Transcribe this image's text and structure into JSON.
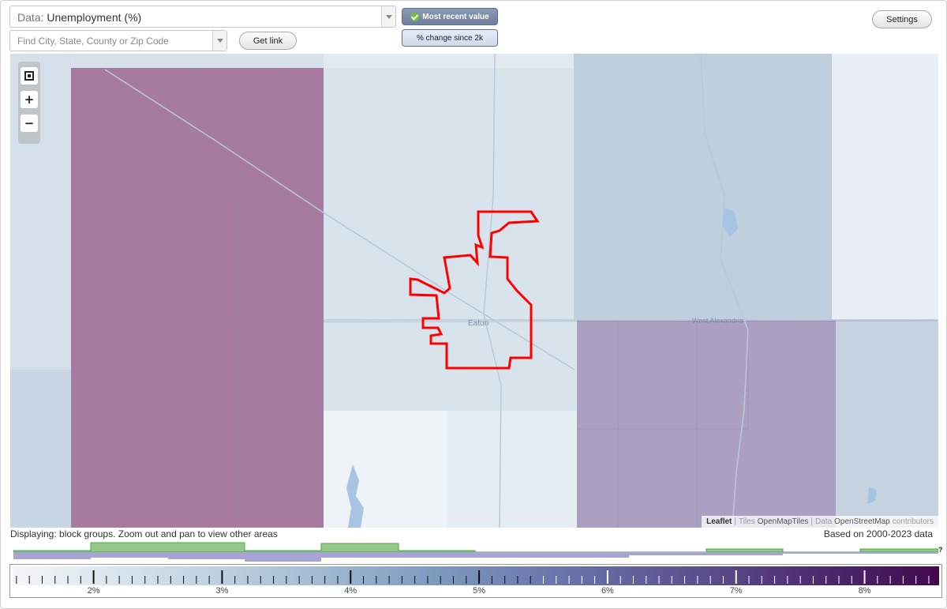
{
  "controls": {
    "data_prefix": "Data:",
    "data_value": "Unemployment (%)",
    "search_placeholder": "Find City, State, County or Zip Code",
    "get_link_label": "Get link",
    "recent_label": "Most recent value",
    "change_label": "% change since 2k",
    "settings_label": "Settings"
  },
  "map": {
    "place_labels": [
      "Eaton",
      "West Alexandria"
    ],
    "highlight_color": "#ff0000",
    "attribution": {
      "leaflet": "Leaflet",
      "sep": "|",
      "tiles_prefix": "Tiles",
      "tiles": "OpenMapTiles",
      "data_prefix": "Data",
      "data_src": "OpenStreetMap",
      "suffix": "contributors"
    }
  },
  "info": {
    "displaying": "Displaying: block groups. Zoom out and pan to view other areas",
    "based_on": "Based on 2000-2023 data",
    "help": "?"
  },
  "legend": {
    "tick_labels": [
      "2%",
      "3%",
      "4%",
      "5%",
      "6%",
      "7%",
      "8%"
    ],
    "domain": [
      1.37,
      8.58
    ],
    "colors": [
      "#f4f6f9",
      "#aac2d6",
      "#6872a9",
      "#43094f"
    ]
  }
}
